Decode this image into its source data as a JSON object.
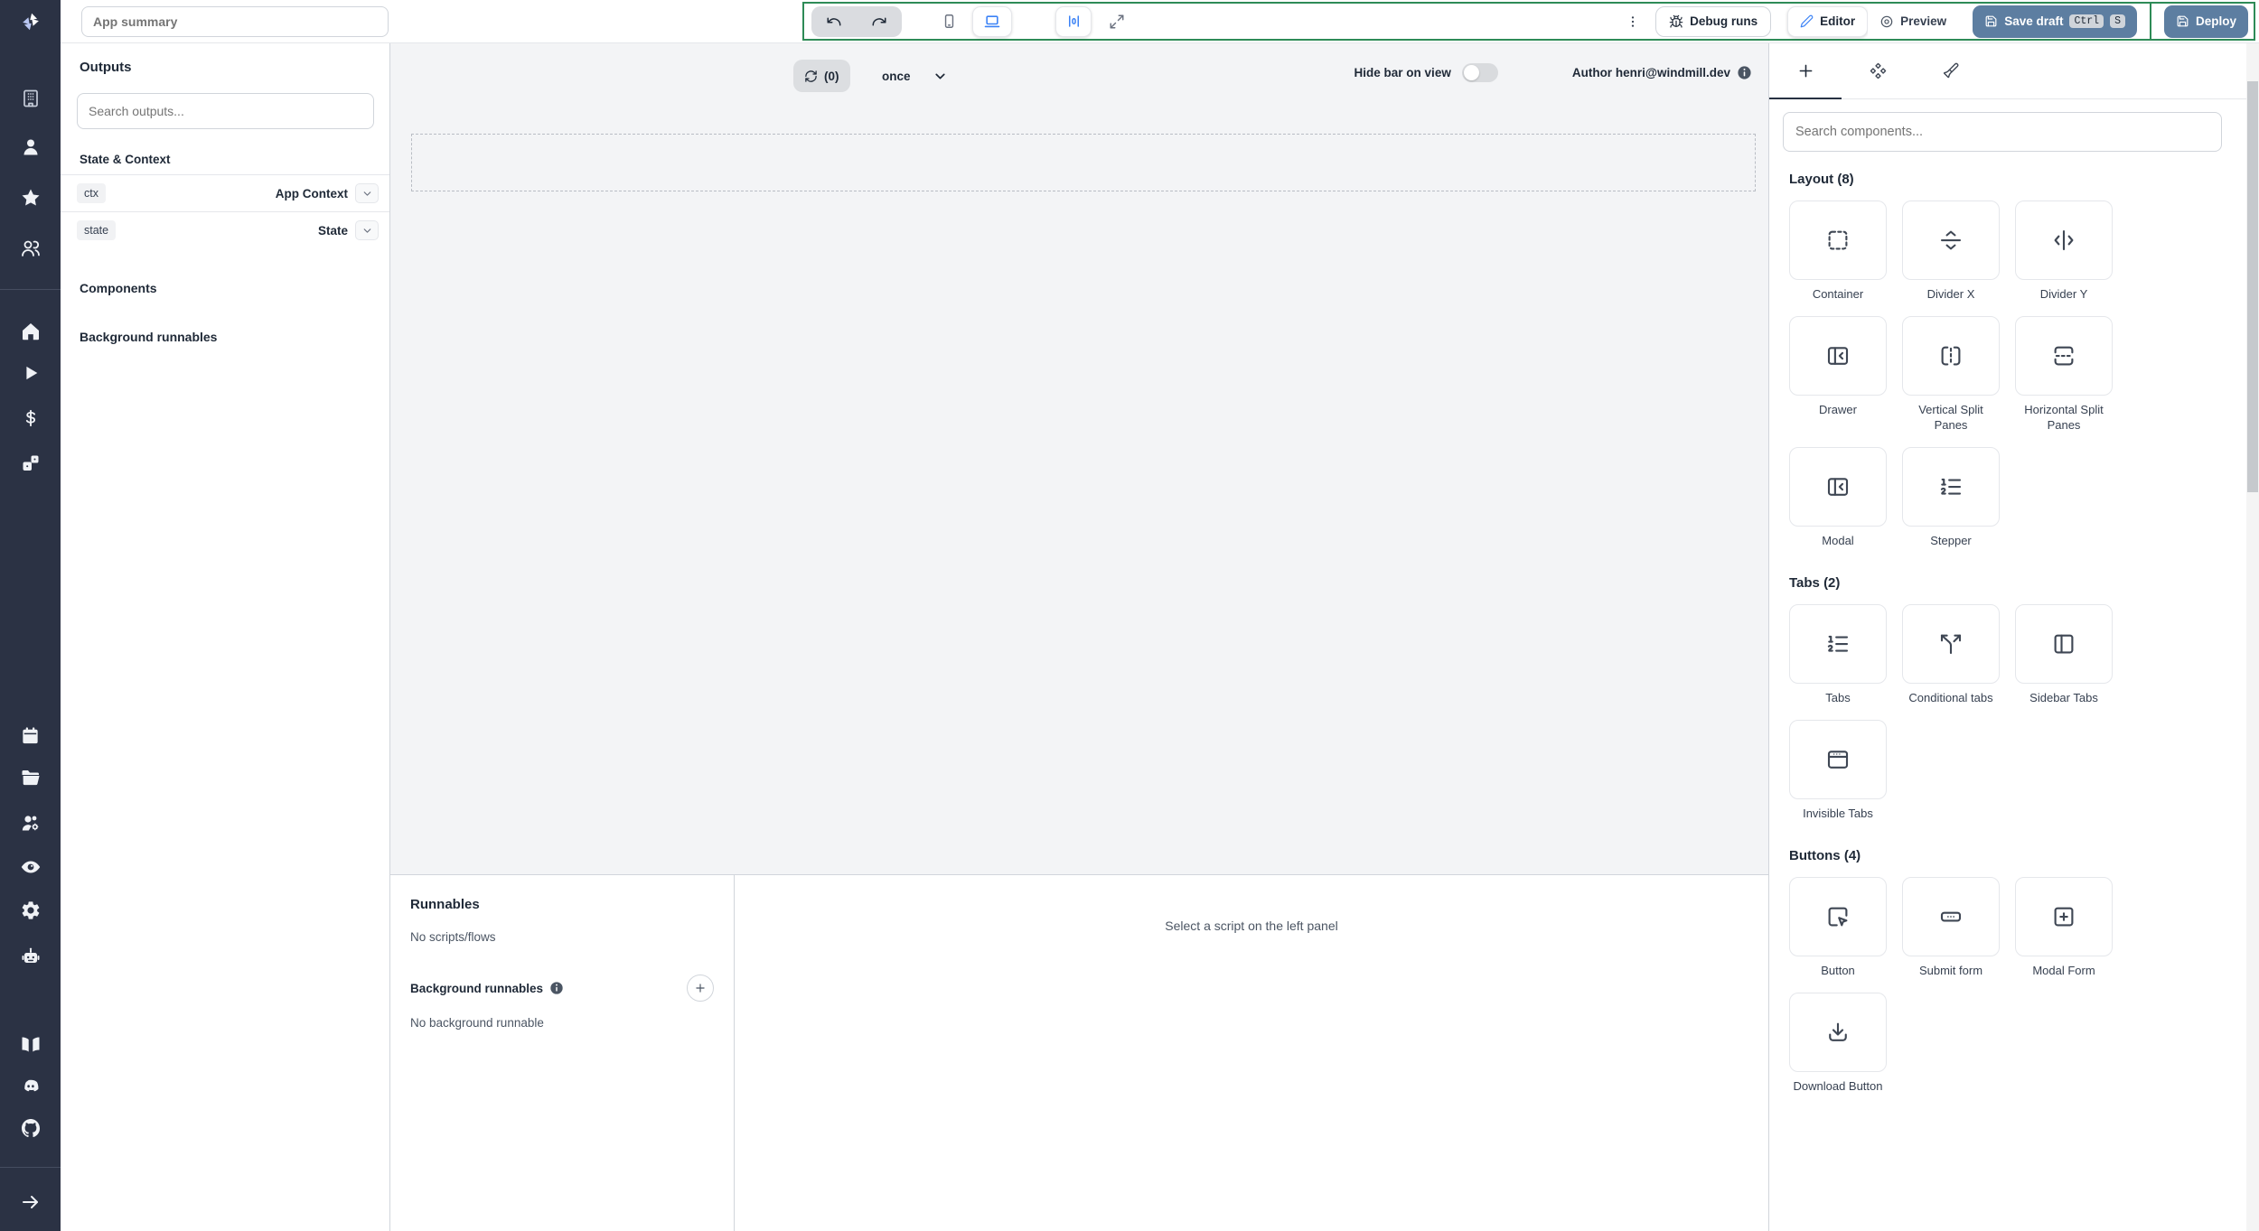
{
  "topbar": {
    "app_summary_placeholder": "App summary",
    "debug_runs_label": "Debug runs",
    "editor_label": "Editor",
    "preview_label": "Preview",
    "save_draft_label": "Save draft",
    "kbd_ctrl": "Ctrl",
    "kbd_s": "S",
    "deploy_label": "Deploy"
  },
  "left_panel": {
    "outputs_title": "Outputs",
    "search_placeholder": "Search outputs...",
    "state_context_title": "State & Context",
    "rows": [
      {
        "key": "ctx",
        "value": "App Context"
      },
      {
        "key": "state",
        "value": "State"
      }
    ],
    "components_title": "Components",
    "background_runnables_title": "Background runnables"
  },
  "canvas": {
    "refresh_count": "(0)",
    "refresh_mode": "once",
    "hide_bar_label": "Hide bar on view",
    "author_label": "Author henri@windmill.dev"
  },
  "bottom_panel": {
    "runnables_title": "Runnables",
    "no_scripts_text": "No scripts/flows",
    "background_runnables_title": "Background runnables",
    "no_background_text": "No background runnable",
    "select_script_hint": "Select a script on the left panel"
  },
  "right_panel": {
    "search_placeholder": "Search components...",
    "sections": [
      {
        "title": "Layout (8)",
        "items": [
          {
            "label": "Container",
            "icon": "container-icon"
          },
          {
            "label": "Divider X",
            "icon": "divider-x-icon"
          },
          {
            "label": "Divider Y",
            "icon": "divider-y-icon"
          },
          {
            "label": "Drawer",
            "icon": "drawer-icon"
          },
          {
            "label": "Vertical Split Panes",
            "icon": "vertical-split-panes-icon"
          },
          {
            "label": "Horizontal Split Panes",
            "icon": "horizontal-split-panes-icon"
          },
          {
            "label": "Modal",
            "icon": "modal-icon"
          },
          {
            "label": "Stepper",
            "icon": "stepper-icon"
          }
        ]
      },
      {
        "title": "Tabs (2)",
        "items": [
          {
            "label": "Tabs",
            "icon": "tabs-icon"
          },
          {
            "label": "Conditional tabs",
            "icon": "conditional-tabs-icon"
          },
          {
            "label": "Sidebar Tabs",
            "icon": "sidebar-tabs-icon"
          },
          {
            "label": "Invisible Tabs",
            "icon": "invisible-tabs-icon"
          }
        ]
      },
      {
        "title": "Buttons (4)",
        "items": [
          {
            "label": "Button",
            "icon": "button-icon"
          },
          {
            "label": "Submit form",
            "icon": "submit-form-icon"
          },
          {
            "label": "Modal Form",
            "icon": "modal-form-icon"
          },
          {
            "label": "Download Button",
            "icon": "download-button-icon"
          }
        ]
      }
    ]
  },
  "sidebar_icon_names": [
    "windmill-logo-icon",
    "building-icon",
    "user-icon",
    "star-icon",
    "users-icon",
    "home-icon",
    "play-icon",
    "dollar-icon",
    "dice-icon",
    "calendar-icon",
    "folder-icon",
    "user-cog-icon",
    "eye-icon",
    "gear-icon",
    "robot-icon",
    "book-icon",
    "discord-icon",
    "github-icon",
    "arrow-right-icon"
  ],
  "colors": {
    "accent_blue": "#3b82f6",
    "action_button_blue": "#5d7ea1",
    "toolbar_outline_green": "#2e8b57",
    "sidebar_bg": "#2b3244",
    "canvas_bg": "#f3f4f6"
  }
}
